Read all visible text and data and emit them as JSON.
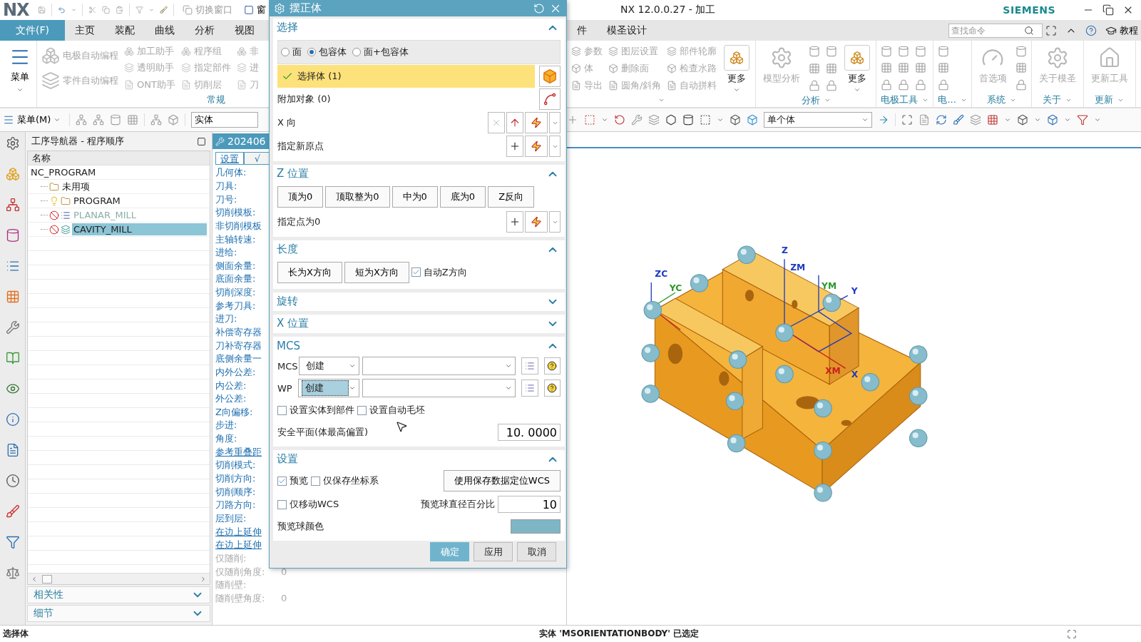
{
  "titlebar": {
    "logo": "NX",
    "switch_window": "切换窗口",
    "window_menu": "窗",
    "title": "NX 12.0.0.27 - 加工",
    "brand": "SIEMENS"
  },
  "menu_tabs": [
    {
      "label": "文件(F)",
      "selected": true
    },
    {
      "label": "主页",
      "selected": false
    },
    {
      "label": "装配",
      "selected": false
    },
    {
      "label": "曲线",
      "selected": false
    },
    {
      "label": "分析",
      "selected": false
    },
    {
      "label": "视图",
      "selected": false
    }
  ],
  "menu_tabs_right": [
    {
      "label": "件",
      "selected": false
    },
    {
      "label": "模圣设计",
      "selected": false
    }
  ],
  "search": {
    "placeholder": "查找命令"
  },
  "tutorial": "教程",
  "ribbon_left": {
    "menu_button": "菜单",
    "columns": [
      [
        "电极自动编程",
        "零件自动编程"
      ],
      [
        "加工助手",
        "透明助手",
        "ONT助手"
      ],
      [
        "程序组",
        "指定部件",
        "切削层"
      ],
      [
        "非",
        "进",
        "刀"
      ]
    ],
    "group": "常规"
  },
  "ribbon_right": [
    {
      "items": [
        {
          "kind": "column",
          "labels": [
            "参数",
            "体",
            "导出"
          ]
        },
        {
          "kind": "column",
          "labels": [
            "图层设置",
            "删除面",
            "圆角/斜角"
          ]
        },
        {
          "kind": "column",
          "labels": [
            "部件轮廓",
            "检查水路",
            "自动拼料"
          ]
        },
        {
          "kind": "more",
          "label": "更多"
        }
      ]
    },
    {
      "label": "分析",
      "items": [
        {
          "kind": "big",
          "label": "模型分析"
        },
        {
          "kind": "icons"
        },
        {
          "kind": "icons"
        },
        {
          "kind": "more",
          "label": "更多"
        }
      ]
    },
    {
      "label": "电极工具",
      "items": [
        {
          "kind": "icons"
        },
        {
          "kind": "icons"
        },
        {
          "kind": "icons"
        }
      ]
    },
    {
      "label": "电...",
      "items": [
        {
          "kind": "icons"
        }
      ]
    },
    {
      "label": "系统",
      "items": [
        {
          "kind": "big",
          "label": "首选项"
        },
        {
          "kind": "icons"
        }
      ]
    },
    {
      "label": "关于",
      "items": [
        {
          "kind": "big",
          "label": "关于模圣"
        }
      ]
    },
    {
      "label": "更新",
      "items": [
        {
          "kind": "big",
          "label": "更新工具"
        }
      ]
    }
  ],
  "toolbar": {
    "menu": "菜单(M)",
    "filter": "实体",
    "selection": "单个体"
  },
  "navigator": {
    "title": "工序导航器 - 程序顺序",
    "column": "名称",
    "root": {
      "label": "NC_PROGRAM",
      "children": [
        {
          "label": "未用项",
          "disabled": false,
          "selected": false
        },
        {
          "label": "PROGRAM",
          "disabled": false,
          "selected": false
        },
        {
          "label": "PLANAR_MILL",
          "disabled": true,
          "selected": false
        },
        {
          "label": "CAVITY_MILL",
          "disabled": false,
          "selected": true
        }
      ]
    },
    "panels": [
      {
        "label": "相关性",
        "expanded": false
      },
      {
        "label": "细节",
        "expanded": false
      }
    ]
  },
  "details": {
    "title": "202406",
    "tabs": [
      {
        "label": "设置",
        "selected": true
      },
      {
        "label": "√",
        "selected": false
      }
    ],
    "rows": [
      {
        "label": "几何体:",
        "link": false,
        "disabled": false
      },
      {
        "label": "刀具:",
        "link": false,
        "disabled": false
      },
      {
        "label": "刀号:",
        "link": false,
        "disabled": false
      },
      {
        "label": "切削模板:",
        "link": false,
        "disabled": false
      },
      {
        "label": "非切削模板",
        "link": false,
        "disabled": false
      },
      {
        "label": "主轴转速:",
        "link": false,
        "disabled": false
      },
      {
        "label": "进给:",
        "link": false,
        "disabled": false
      },
      {
        "label": "侧面余量:",
        "link": false,
        "disabled": false
      },
      {
        "label": "底面余量:",
        "link": false,
        "disabled": false
      },
      {
        "label": "切削深度:",
        "link": false,
        "disabled": false
      },
      {
        "label": "参考刀具:",
        "link": false,
        "disabled": false
      },
      {
        "label": "进刀:",
        "link": false,
        "disabled": false
      },
      {
        "label": "补偿寄存器",
        "link": false,
        "disabled": false
      },
      {
        "label": "刀补寄存器",
        "link": false,
        "disabled": false
      },
      {
        "label": "底侧余量一",
        "link": false,
        "disabled": false
      },
      {
        "label": "内外公差:",
        "link": false,
        "disabled": false
      },
      {
        "label": "内公差:",
        "link": false,
        "disabled": false
      },
      {
        "label": "外公差:",
        "link": false,
        "disabled": false
      },
      {
        "label": "Z向偏移:",
        "link": false,
        "disabled": false
      },
      {
        "label": "步进:",
        "link": false,
        "disabled": false
      },
      {
        "label": "角度:",
        "link": false,
        "disabled": false
      },
      {
        "label": "参考重叠距",
        "link": true,
        "disabled": false
      },
      {
        "label": "切削模式:",
        "link": false,
        "disabled": false
      },
      {
        "label": "切削方向:",
        "link": false,
        "disabled": false
      },
      {
        "label": "切削顺序:",
        "link": false,
        "disabled": false
      },
      {
        "label": "刀路方向:",
        "link": false,
        "disabled": false
      },
      {
        "label": "层到层:",
        "link": false,
        "disabled": false
      },
      {
        "label": "在边上延伸",
        "link": true,
        "disabled": false
      },
      {
        "label": "在边上延伸",
        "link": true,
        "disabled": false
      },
      {
        "label": "仅随削:",
        "link": false,
        "disabled": true
      },
      {
        "label": "仅随削角度:",
        "value": "0",
        "link": false,
        "disabled": true
      },
      {
        "label": "随削壁:",
        "link": false,
        "disabled": true
      },
      {
        "label": "随削壁角度:",
        "value": "0",
        "link": false,
        "disabled": true
      }
    ]
  },
  "dialog": {
    "title": "摆正体",
    "sections": [
      {
        "kind": "select",
        "title": "选择",
        "expanded": true,
        "radios": [
          {
            "label": "面",
            "selected": false
          },
          {
            "label": "包容体",
            "selected": true
          },
          {
            "label": "面+包容体",
            "selected": false
          }
        ],
        "select_body": "选择体 (1)",
        "extra": "附加对象 (0)",
        "x_dir": "X 向",
        "new_origin": "指定新原点"
      },
      {
        "kind": "zpos",
        "title": "Z 位置",
        "expanded": true,
        "buttons": [
          "顶为0",
          "顶取整为0",
          "中为0",
          "底为0",
          "Z反向"
        ],
        "point": "指定点为0"
      },
      {
        "kind": "length",
        "title": "长度",
        "expanded": true,
        "buttons": [
          "长为X方向",
          "短为X方向"
        ],
        "auto_z": {
          "label": "自动Z方向",
          "checked": true
        }
      },
      {
        "kind": "collapsed",
        "title": "旋转",
        "expanded": false
      },
      {
        "kind": "collapsed",
        "title": "X 位置",
        "expanded": false
      },
      {
        "kind": "mcs",
        "title": "MCS",
        "expanded": true,
        "rows": [
          {
            "label": "MCS",
            "mode": "创建",
            "focused": false
          },
          {
            "label": "WP",
            "mode": "创建",
            "focused": true
          }
        ],
        "checks": [
          {
            "label": "设置实体到部件",
            "checked": false
          },
          {
            "label": "设置自动毛坯",
            "checked": false
          }
        ],
        "safe_plane": {
          "label": "安全平面(体最高偏置)",
          "value": "10. 0000"
        }
      },
      {
        "kind": "settings",
        "title": "设置",
        "expanded": true,
        "checks": [
          {
            "label": "预览",
            "checked": true
          },
          {
            "label": "仅保存坐标系",
            "checked": false
          }
        ],
        "wcs_button": "使用保存数据定位WCS",
        "move_wcs": {
          "label": "仅移动WCS",
          "checked": false
        },
        "ball_pct": {
          "label": "预览球直径百分比",
          "value": "10"
        },
        "ball_color": {
          "label": "预览球颜色",
          "color": "#7fb6c6"
        }
      }
    ],
    "buttons": [
      {
        "label": "确定",
        "primary": true
      },
      {
        "label": "应用",
        "primary": false
      },
      {
        "label": "取消",
        "primary": false
      }
    ]
  },
  "model": {
    "axis_labels": [
      {
        "text": "Z",
        "color": "#1e3cc0"
      },
      {
        "text": "ZM",
        "color": "#1e3cc0"
      },
      {
        "text": "ZC",
        "color": "#1e3cc0"
      },
      {
        "text": "YC",
        "color": "#2a9a2a"
      },
      {
        "text": "YM",
        "color": "#2a9a2a"
      },
      {
        "text": "Y",
        "color": "#1e3cc0"
      },
      {
        "text": "XM",
        "color": "#c82020"
      },
      {
        "text": "X",
        "color": "#1e3cc0"
      }
    ]
  },
  "status": {
    "prompt": "选择体",
    "message": "实体 'MSORIENTATIONBODY' 已选定"
  }
}
